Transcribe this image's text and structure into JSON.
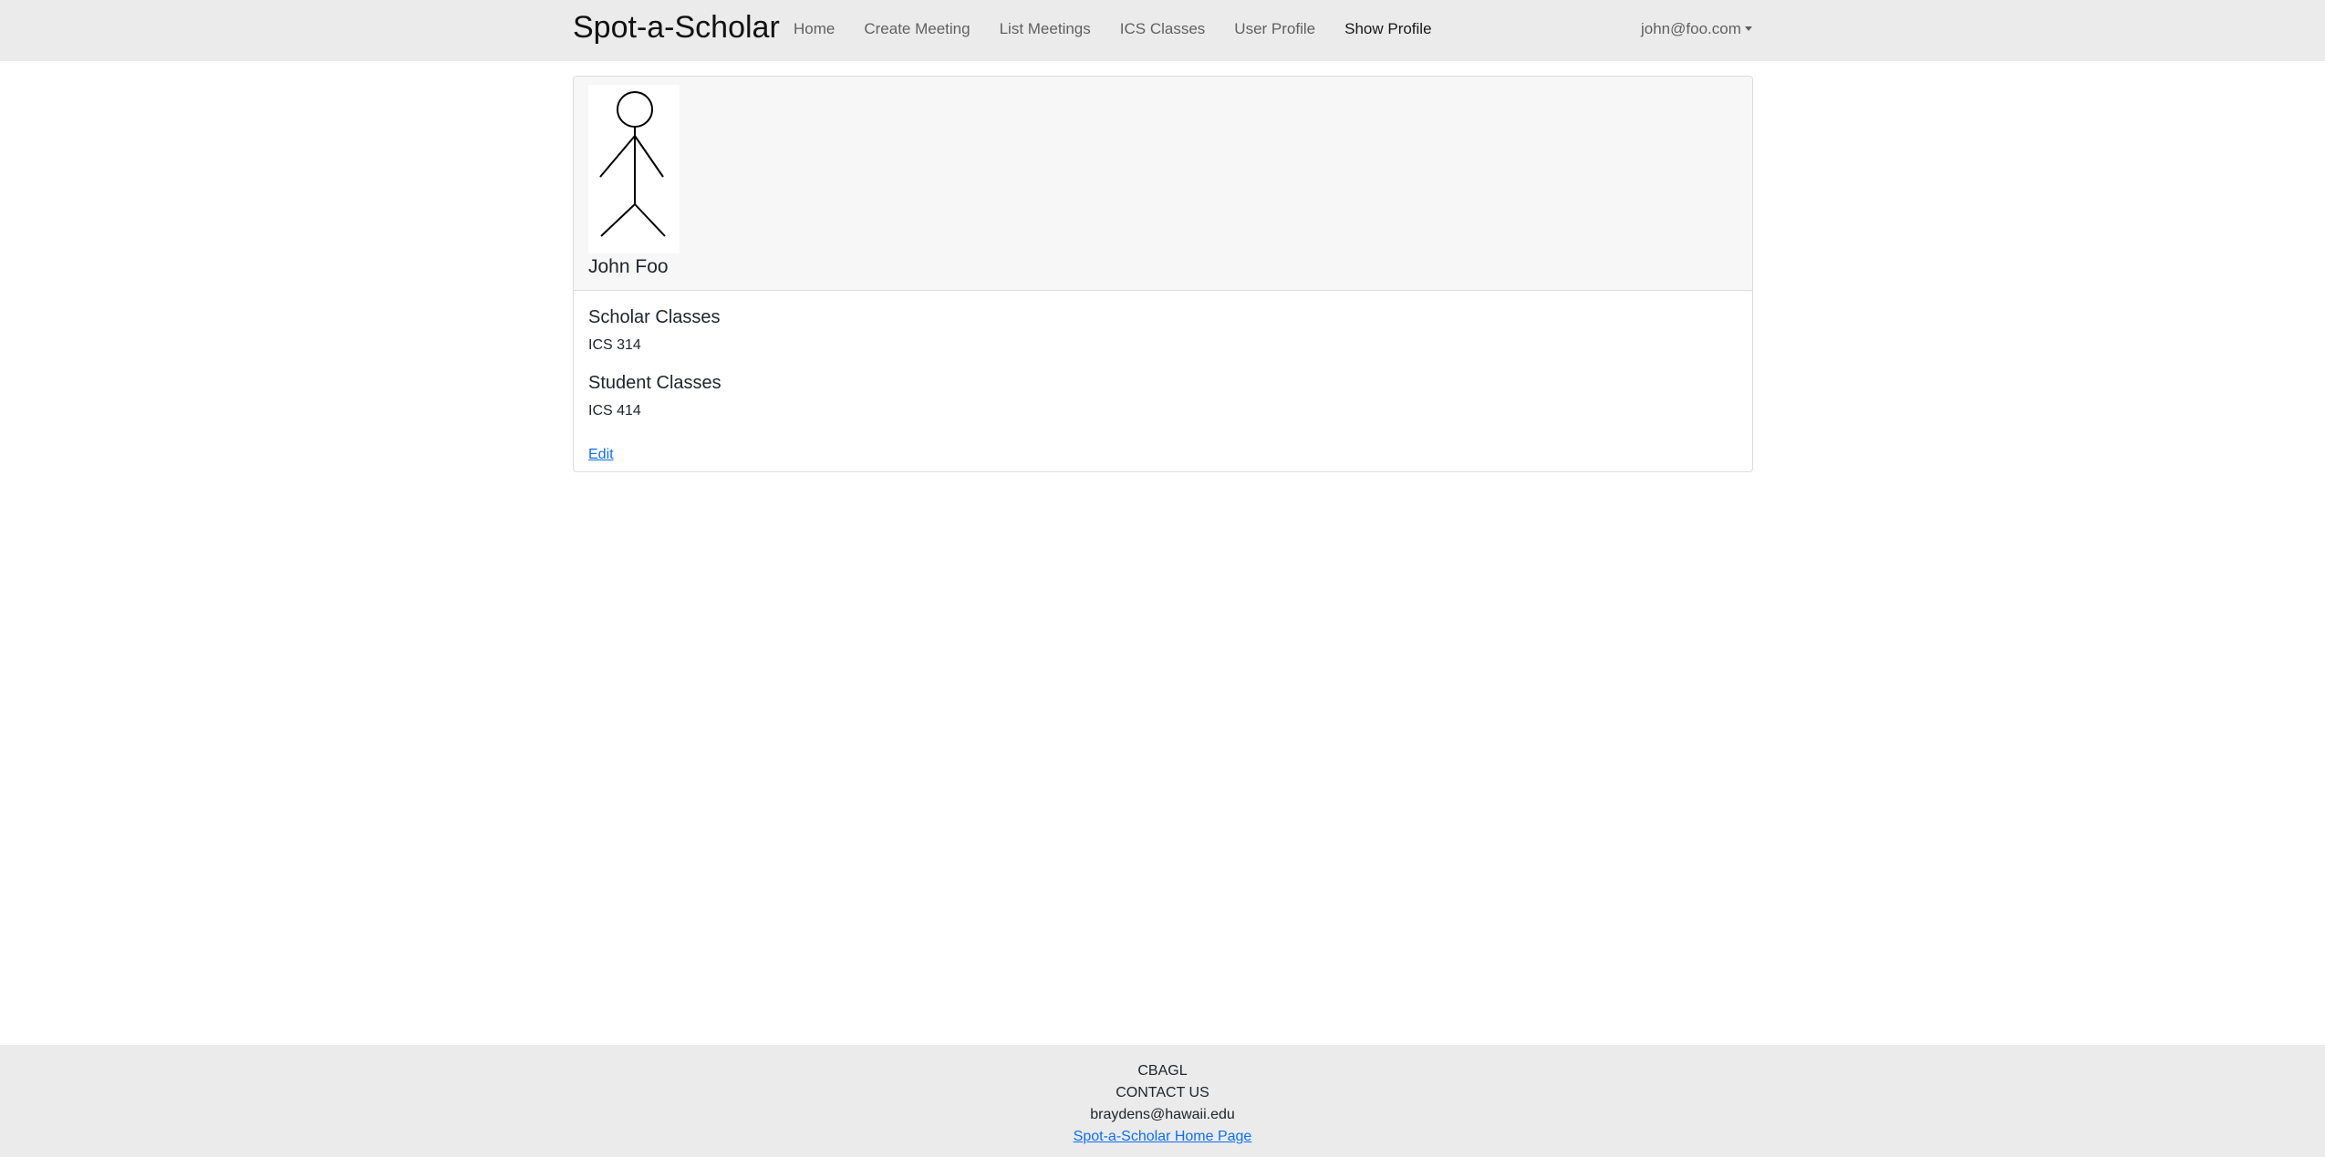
{
  "navbar": {
    "brand": "Spot-a-Scholar",
    "links": [
      {
        "label": "Home"
      },
      {
        "label": "Create Meeting"
      },
      {
        "label": "List Meetings"
      },
      {
        "label": "ICS Classes"
      },
      {
        "label": "User Profile"
      },
      {
        "label": "Show Profile",
        "active": true
      }
    ],
    "user": "john@foo.com"
  },
  "profile": {
    "avatar_icon": "stick-figure-icon",
    "name": "John Foo",
    "scholar_classes_title": "Scholar Classes",
    "scholar_classes": [
      "ICS 314"
    ],
    "student_classes_title": "Student Classes",
    "student_classes": [
      "ICS 414"
    ],
    "edit_label": "Edit"
  },
  "footer": {
    "org": "CBAGL",
    "contact": "CONTACT US",
    "email": "braydens@hawaii.edu",
    "home_link": "Spot-a-Scholar Home Page"
  },
  "colors": {
    "navbar_bg": "#ebebeb",
    "card_header_bg": "#f7f7f7",
    "link": "#0d6efd"
  }
}
